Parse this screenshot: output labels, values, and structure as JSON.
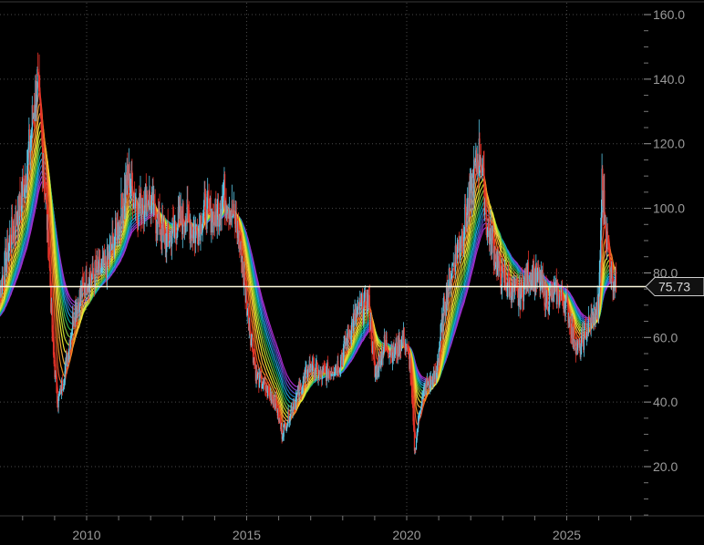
{
  "chart_data": {
    "type": "line",
    "title": "",
    "xlabel": "",
    "ylabel": "",
    "xlim": [
      2006.6,
      2028.6
    ],
    "ylim": [
      5,
      163
    ],
    "x_ticks": [
      {
        "value": 2010,
        "label": "2010"
      },
      {
        "value": 2015,
        "label": "2015"
      },
      {
        "value": 2020,
        "label": "2020"
      },
      {
        "value": 2025,
        "label": "2025"
      }
    ],
    "y_ticks": [
      {
        "value": 160,
        "label": "160.0"
      },
      {
        "value": 140,
        "label": "140.0"
      },
      {
        "value": 120,
        "label": "120.0"
      },
      {
        "value": 100,
        "label": "100.0"
      },
      {
        "value": 80,
        "label": "80.0"
      },
      {
        "value": 60,
        "label": "60.0"
      },
      {
        "value": 40,
        "label": "40.0"
      },
      {
        "value": 20,
        "label": "20.0"
      }
    ],
    "minor_y_step": 5,
    "grid": true,
    "current_price": {
      "value": 75.73,
      "label": "75.73",
      "line_color": "#fffbe0"
    },
    "candle_colors": {
      "up": "#5bc8e8",
      "down": "#e8342a"
    },
    "ribbon_colors": [
      "#e8342a",
      "#f05a28",
      "#f7941d",
      "#fbb040",
      "#f9ed32",
      "#c8e02c",
      "#8dc63f",
      "#39b54a",
      "#00a99d",
      "#27aae1",
      "#1c75bc",
      "#5b4fd0",
      "#8b3fd6",
      "#b12ad6"
    ],
    "series": [
      {
        "type": "candlestick-approx",
        "x": [
          2007.0,
          2007.3,
          2007.6,
          2007.9,
          2008.2,
          2008.45,
          2008.6,
          2008.8,
          2008.95,
          2009.1,
          2009.3,
          2009.6,
          2010.0,
          2010.3,
          2010.6,
          2011.0,
          2011.3,
          2011.6,
          2011.9,
          2012.2,
          2012.5,
          2012.8,
          2013.1,
          2013.4,
          2013.7,
          2014.0,
          2014.3,
          2014.5,
          2014.75,
          2015.0,
          2015.3,
          2015.6,
          2015.9,
          2016.1,
          2016.4,
          2016.7,
          2017.0,
          2017.3,
          2017.6,
          2017.9,
          2018.2,
          2018.5,
          2018.8,
          2019.0,
          2019.3,
          2019.6,
          2019.9,
          2020.1,
          2020.25,
          2020.4,
          2020.6,
          2020.9,
          2021.2,
          2021.5,
          2021.8,
          2022.1,
          2022.3,
          2022.5,
          2022.7,
          2022.9,
          2023.2,
          2023.5,
          2023.8,
          2024.1,
          2024.4,
          2024.7,
          2025.0,
          2025.2,
          2025.4,
          2025.6,
          2025.8,
          2026.0,
          2026.1,
          2026.25,
          2026.4,
          2026.55
        ],
        "close": [
          65,
          75,
          90,
          100,
          118,
          140,
          120,
          90,
          55,
          40,
          48,
          68,
          78,
          80,
          82,
          95,
          110,
          100,
          104,
          96,
          90,
          95,
          98,
          92,
          100,
          97,
          105,
          100,
          92,
          70,
          48,
          44,
          40,
          30,
          38,
          45,
          52,
          48,
          50,
          52,
          62,
          68,
          72,
          48,
          58,
          55,
          60,
          52,
          24,
          38,
          45,
          48,
          72,
          85,
          95,
          110,
          118,
          95,
          88,
          80,
          76,
          72,
          80,
          78,
          72,
          74,
          70,
          60,
          56,
          62,
          66,
          70,
          108,
          90,
          80,
          75.73
        ]
      },
      {
        "name": "",
        "type": "ema",
        "period": 5
      },
      {
        "name": "",
        "type": "ema",
        "period": 70
      }
    ]
  }
}
